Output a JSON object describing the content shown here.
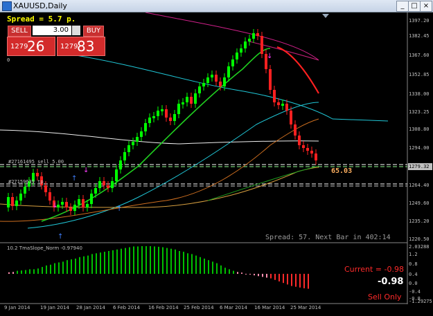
{
  "window": {
    "title": "XAUUSD,Daily"
  },
  "trade_panel": {
    "spread_label": "Spread = 5.7 p.",
    "sell_label": "SELL",
    "buy_label": "BUY",
    "lots_value": "3.00",
    "bid_prefix": "1279",
    "bid_big": "26",
    "ask_prefix": "1279",
    "ask_big": "83"
  },
  "main_chart": {
    "symbol_flag": "0",
    "price_labels": [
      "1397.20",
      "1382.45",
      "1367.60",
      "1352.85",
      "1338.00",
      "1323.25",
      "1308.80",
      "1294.00",
      "1279.32",
      "1264.40",
      "1249.60",
      "1235.20",
      "1220.50"
    ],
    "current_price_tag": "1279.32",
    "order_line_1": "#27161495 sell 5.00",
    "order_line_2": "#27159639 tp",
    "pips_label": "65.03",
    "status_text": "Spread: 57. Next Bar in 402:14"
  },
  "indicator": {
    "name": "10.2 TmaSlope_Norm -0.97940",
    "current_label": "Current = -0.98",
    "value_label": "-0.98",
    "signal_label": "Sell Only",
    "scale_labels": [
      "2.03288",
      "1.2",
      "0.8",
      "0.4",
      "0.0",
      "-0.4",
      "-0.8",
      "-1.29275"
    ],
    "colors": {
      "up": "#00c000",
      "weak": "#ff8fb0",
      "down": "#ff2a2a"
    }
  },
  "x_axis": [
    "9 Jan 2014",
    "19 Jan 2014",
    "28 Jan 2014",
    "6 Feb 2014",
    "16 Feb 2014",
    "25 Feb 2014",
    "6 Mar 2014",
    "16 Mar 2014",
    "25 Mar 2014"
  ],
  "colors": {
    "bull": "#00ff00",
    "bear": "#ff2020",
    "background": "#000000"
  }
}
